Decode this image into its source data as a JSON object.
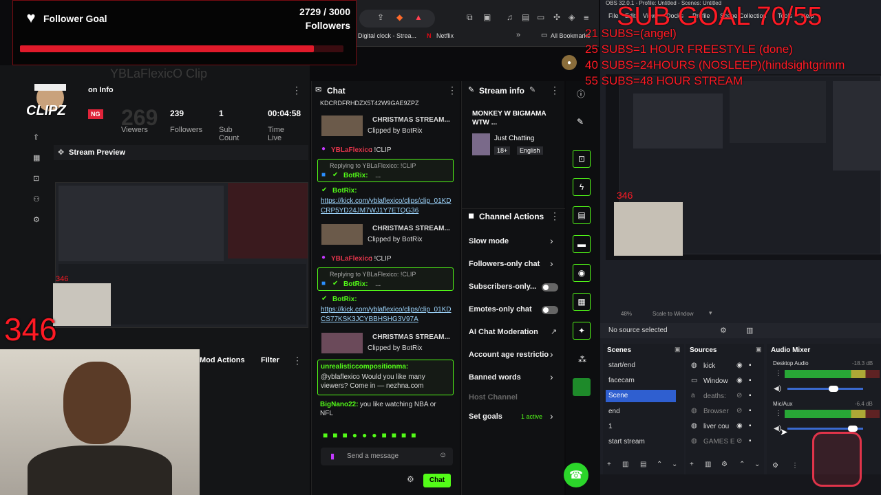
{
  "follower_goal": {
    "title": "Follower Goal",
    "count": "2729 / 3000",
    "unit": "Followers",
    "progress": 0.909
  },
  "browser": {
    "bookmarks": [
      "Digital clock - Strea...",
      "Netflix",
      "All Bookmarks"
    ]
  },
  "sub_goal": {
    "title": "SUB GOAL 70/55",
    "lines": [
      "21 SUBS=(angel)",
      "25 SUBS=1 HOUR FREESTYLE (done)",
      "40 SUBS=24HOURS (NOSLEEP)(hindsightgrimm",
      "55 SUBS=48 HOUR STREAM"
    ]
  },
  "obs_title": "OBS 32.0.1 - Profile: Untitled - Scenes: Untitled",
  "obs_menu": [
    "File",
    "Edit",
    "View",
    "Docks",
    "Profile",
    "Scene Collection",
    "Tools",
    "Help"
  ],
  "dashboard": {
    "session_title": "on Info",
    "live_badge": "NG",
    "stats": [
      {
        "value": "269",
        "label": "Viewers"
      },
      {
        "value": "239",
        "label": "Followers"
      },
      {
        "value": "1",
        "label": "Sub Count"
      },
      {
        "value": "00:04:58",
        "label": "Time Live"
      }
    ],
    "preview_title": "Stream Preview",
    "preview_count": "346",
    "channel_watermark": "YBLaFlexicO Clip"
  },
  "big_counter": "346",
  "logo_text": "CLIPZ",
  "chat": {
    "title": "Chat",
    "top_line": "KDCRDFRHDZX5T42W9GAE9ZPZ",
    "messages": [
      {
        "type": "clip",
        "title": "CHRISTMAS STREAM...",
        "by": "Clipped by BotRix"
      },
      {
        "type": "cmd",
        "user": "YBLaFlexico",
        "text": ": !CLIP"
      },
      {
        "type": "reply",
        "reply": "Replying to YBLaFlexico: !CLIP",
        "user": "BotRix:",
        "text": "...",
        "user2": "BotRix:",
        "link": "https://kick.com/yblaflexico/clips/clip_01KDCRP5YD24JM7WJ1Y7ETQG36"
      },
      {
        "type": "clip",
        "title": "CHRISTMAS STREAM...",
        "by": "Clipped by BotRix"
      },
      {
        "type": "cmd",
        "user": "YBLaFlexico",
        "text": ": !CLIP"
      },
      {
        "type": "reply",
        "reply": "Replying to YBLaFlexico: !CLIP",
        "user": "BotRix:",
        "text": "...",
        "user2": "BotRix:",
        "link": "https://kick.com/yblaflexico/clips/clip_01KDCS77KSK3JCYBBHSHG3V97A"
      },
      {
        "type": "clip",
        "title": "CHRISTMAS STREAM...",
        "by": "Clipped by BotRix"
      }
    ],
    "promo_user": "unrealisticcompositionma:",
    "promo_text": "@yblaflexico Would you like many viewers? Come in — nezhna.com",
    "last_user": "BigNano22:",
    "last_text": "you like watching NBA or NFL",
    "placeholder": "Send a message",
    "send_label": "Chat"
  },
  "stream_info": {
    "title": "Stream info",
    "stream_title": "MONKEY W BIGMAMA WTW ...",
    "category": "Just Chatting",
    "tags": [
      "18+",
      "English"
    ]
  },
  "channel_actions": {
    "title": "Channel Actions",
    "items": [
      {
        "label": "Slow mode",
        "control": "chevron"
      },
      {
        "label": "Followers-only chat",
        "control": "chevron"
      },
      {
        "label": "Subscribers-only...",
        "control": "toggle"
      },
      {
        "label": "Emotes-only chat",
        "control": "toggle"
      },
      {
        "label": "AI Chat Moderation",
        "control": "external"
      },
      {
        "label": "Account age restrictio",
        "control": "chevron"
      },
      {
        "label": "Banned words",
        "control": "chevron"
      },
      {
        "label": "Host Channel",
        "control": "none"
      },
      {
        "label": "Set goals",
        "control": "chevron",
        "badge": "1 active"
      }
    ]
  },
  "obs": {
    "zoom": "48%",
    "scale_label": "Scale to Window",
    "source_status": "No source selected",
    "scenes_title": "Scenes",
    "scenes": [
      "start/end",
      "facecam",
      "Scene",
      "end",
      "1",
      "start stream"
    ],
    "active_scene": "Scene",
    "sources_title": "Sources",
    "sources": [
      "kick",
      "Window",
      "deaths:",
      "Browser",
      "liver cou",
      "GAMES E"
    ],
    "mixer_title": "Audio Mixer",
    "mixer": [
      {
        "name": "Desktop Audio",
        "db": "-18.3 dB"
      },
      {
        "name": "Mic/Aux",
        "db": "-6.4 dB"
      }
    ]
  },
  "colors": {
    "kick_green": "#53fc18",
    "goal_red": "#ff1a24",
    "scene_selected": "#2f5fd0"
  }
}
